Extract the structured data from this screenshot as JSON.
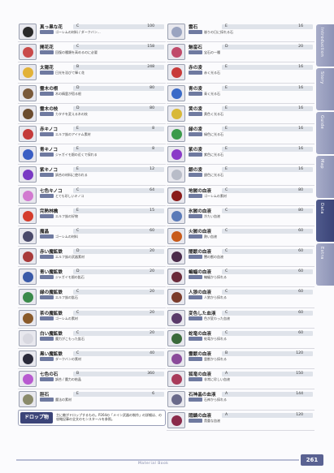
{
  "left_entries": [
    {
      "name": "真っ黒な花",
      "lv": "C",
      "val": "100",
      "desc": "ゴーレムの材料 / ダークバン…",
      "color": "#2a2a2a"
    },
    {
      "name": "開花花",
      "lv": "C",
      "val": "158",
      "desc": "回復の種類を高めるのに必要",
      "color": "#c94a4a"
    },
    {
      "name": "太陽花",
      "lv": "B",
      "val": "248",
      "desc": "日光を浴びて輝く花",
      "color": "#e2b238"
    },
    {
      "name": "霊木の根",
      "lv": "D",
      "val": "80",
      "desc": "木の精霊が宿る根",
      "color": "#7a5a3a"
    },
    {
      "name": "霊木の枝",
      "lv": "D",
      "val": "80",
      "desc": "カタチを変える木の枝",
      "color": "#6b4c2e"
    },
    {
      "name": "赤キノコ",
      "lv": "E",
      "val": "8",
      "desc": "エルフ族のアイテム素材",
      "color": "#c43a3a"
    },
    {
      "name": "青キノコ",
      "lv": "E",
      "val": "8",
      "desc": "ジャガイモ畑の近くで採れる",
      "color": "#3a5ec4"
    },
    {
      "name": "紫キノコ",
      "lv": "E",
      "val": "12",
      "desc": "調合の材料に使われる",
      "color": "#7a3ac4"
    },
    {
      "name": "七色キノコ",
      "lv": "C",
      "val": "64",
      "desc": "とても珍しいキノコ",
      "color": "#d27ad0"
    },
    {
      "name": "完熟林檎",
      "lv": "E",
      "val": "15",
      "desc": "エルフ族の好物",
      "color": "#d43c2c"
    },
    {
      "name": "魔晶",
      "lv": "C",
      "val": "60",
      "desc": "ゴーレムの材料",
      "color": "#4a4a6a"
    },
    {
      "name": "赤い魔鉱鉄",
      "lv": "D",
      "val": "20",
      "desc": "エルフ族の武器素材",
      "color": "#a83a3a"
    },
    {
      "name": "青い魔鉱鉄",
      "lv": "D",
      "val": "20",
      "desc": "ジャガイモ畑の鉱石",
      "color": "#3a5aa8"
    },
    {
      "name": "緑の魔鉱鉄",
      "lv": "C",
      "val": "20",
      "desc": "エルフ族の鉱石",
      "color": "#3a8a4a"
    },
    {
      "name": "茶の魔鉱鉄",
      "lv": "C",
      "val": "20",
      "desc": "ゴーレムの素材",
      "color": "#8a5a2a"
    },
    {
      "name": "白い魔鉱鉄",
      "lv": "C",
      "val": "20",
      "desc": "魔力がこもった鉱石",
      "color": "#d8d8e0"
    },
    {
      "name": "黒い魔鉱鉄",
      "lv": "C",
      "val": "40",
      "desc": "ダークバンの素材",
      "color": "#2a2a3a"
    },
    {
      "name": "七色の石",
      "lv": "B",
      "val": "360",
      "desc": "調合 / 魔力の結晶",
      "color": "#b85ad0"
    },
    {
      "name": "胆石",
      "lv": "E",
      "val": "6",
      "desc": "魔法の素材",
      "color": "#8a8a6a"
    }
  ],
  "right_entries": [
    {
      "name": "雲石",
      "lv": "E",
      "val": "16",
      "desc": "曇りの日に採れる石",
      "color": "#9aa4c0"
    },
    {
      "name": "魅蛮石",
      "lv": "D",
      "val": "20",
      "desc": "宝石の一種",
      "color": "#c04a6a"
    },
    {
      "name": "赤の凌",
      "lv": "E",
      "val": "16",
      "desc": "赤く光る石",
      "color": "#c83a3a"
    },
    {
      "name": "青の凌",
      "lv": "E",
      "val": "16",
      "desc": "青く光る石",
      "color": "#3a6ac8"
    },
    {
      "name": "黄の凌",
      "lv": "E",
      "val": "16",
      "desc": "黄色く光る石",
      "color": "#d8b838"
    },
    {
      "name": "緑の凌",
      "lv": "E",
      "val": "16",
      "desc": "緑色に光る石",
      "color": "#3a9a4a"
    },
    {
      "name": "紫の凌",
      "lv": "E",
      "val": "16",
      "desc": "紫色に光る石",
      "color": "#8a3ac8"
    },
    {
      "name": "銀の凌",
      "lv": "E",
      "val": "16",
      "desc": "銀色に光る石",
      "color": "#b8bcc8"
    },
    {
      "name": "地獄の血液",
      "lv": "C",
      "val": "80",
      "desc": "ゴーレムの素材",
      "color": "#8a1a1a"
    },
    {
      "name": "氷獄の血液",
      "lv": "C",
      "val": "80",
      "desc": "冷たい血液",
      "color": "#5a7ab8"
    },
    {
      "name": "火獄の血液",
      "lv": "C",
      "val": "60",
      "desc": "熱い血液",
      "color": "#c85a1a"
    },
    {
      "name": "闇獣の血液",
      "lv": "C",
      "val": "60",
      "desc": "闇の獣の血液",
      "color": "#4a2a4a"
    },
    {
      "name": "蝙蝠の血液",
      "lv": "C",
      "val": "60",
      "desc": "蝙蝠から採れる",
      "color": "#6a2a3a"
    },
    {
      "name": "人狼の血液",
      "lv": "C",
      "val": "60",
      "desc": "人狼から採れる",
      "color": "#7a3a2a"
    },
    {
      "name": "変色した血液",
      "lv": "C",
      "val": "60",
      "desc": "色が変わった血液",
      "color": "#5a3a6a"
    },
    {
      "name": "蛇竜の血液",
      "lv": "C",
      "val": "60",
      "desc": "蛇竜から採れる",
      "color": "#3a6a3a"
    },
    {
      "name": "霊獣の血液",
      "lv": "B",
      "val": "120",
      "desc": "霊獣から採れる",
      "color": "#8a4a9a"
    },
    {
      "name": "狐竜の血液",
      "lv": "A",
      "val": "150",
      "desc": "非常に珍しい血液",
      "color": "#a83a5a"
    },
    {
      "name": "石神晶の血液",
      "lv": "A",
      "val": "144",
      "desc": "石神から採れる",
      "color": "#6a6a8a"
    },
    {
      "name": "悶鎮の血液",
      "lv": "A",
      "val": "120",
      "desc": "貴重な血液",
      "color": "#8a2a4a"
    }
  ],
  "drop_box": {
    "label": "ドロップ物",
    "text": "主に敵がドロップするもの。P264の「メイン武器の制作」の詳細は、の攻略記事の全文のモンスタールを参照。"
  },
  "side_tabs": [
    {
      "label": "Introduction",
      "active": false
    },
    {
      "label": "Story",
      "active": false
    },
    {
      "label": "Guide",
      "active": false
    },
    {
      "label": "Map",
      "active": false
    },
    {
      "label": "Data",
      "active": true
    },
    {
      "label": "Extra",
      "active": false
    }
  ],
  "footer": {
    "text": "Material Book",
    "page": "261"
  }
}
